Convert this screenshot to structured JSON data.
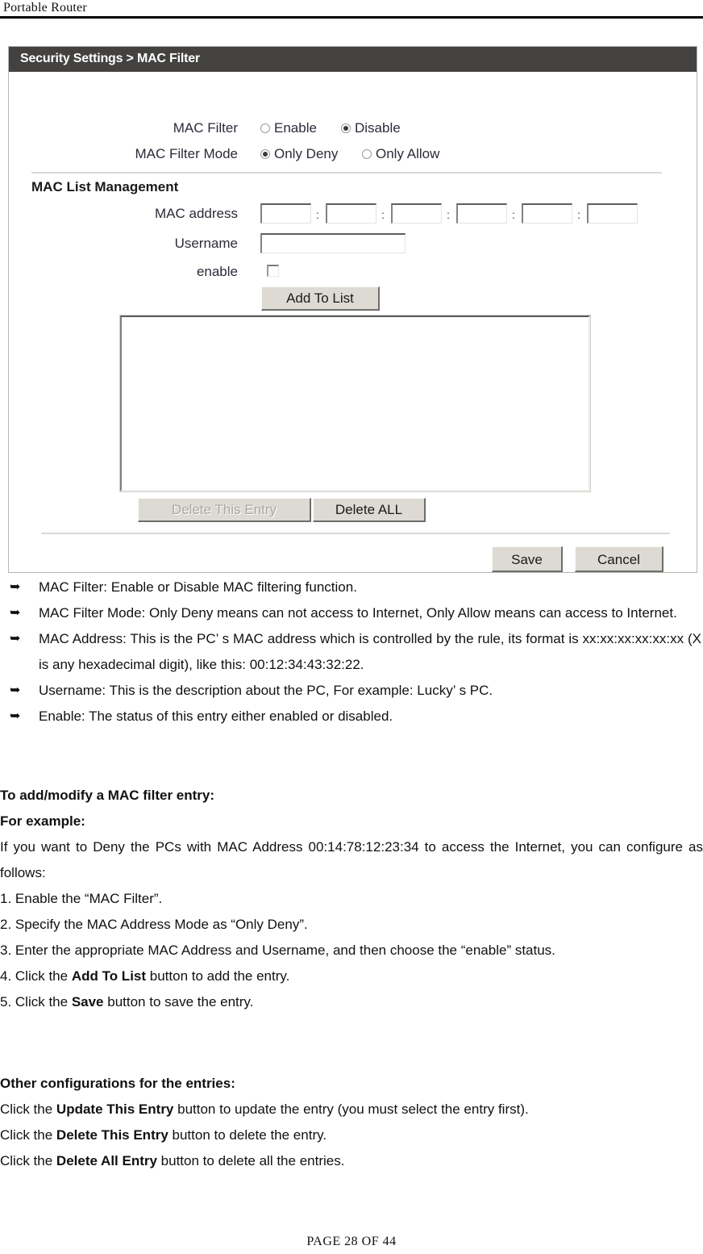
{
  "document": {
    "running_header": "Portable Router",
    "footer": "PAGE   28   OF   44"
  },
  "panel": {
    "breadcrumb": "Security Settings > MAC Filter",
    "accent_header_color": "#434240",
    "fields": {
      "mac_filter": {
        "label": "MAC Filter",
        "options": [
          "Enable",
          "Disable"
        ],
        "selected": "Disable"
      },
      "mac_filter_mode": {
        "label": "MAC Filter Mode",
        "options": [
          "Only Deny",
          "Only Allow"
        ],
        "selected": "Only Deny"
      }
    },
    "list_management": {
      "section_title": "MAC List Management",
      "mac_address_label": "MAC address",
      "mac_address_values": [
        "",
        "",
        "",
        "",
        "",
        ""
      ],
      "separator": ":",
      "username_label": "Username",
      "username_value": "",
      "enable_label": "enable",
      "enable_checked": false,
      "add_to_list_label": "Add To List",
      "entries": [],
      "delete_this_entry_label": "Delete This Entry",
      "delete_this_entry_disabled": true,
      "delete_all_label": "Delete ALL"
    },
    "actions": {
      "save_label": "Save",
      "cancel_label": "Cancel"
    }
  },
  "bullets": [
    "MAC Filter: Enable or Disable MAC filtering function.",
    "MAC Filter Mode: Only Deny means can not access to Internet, Only Allow means can access to Internet.",
    "MAC Address: This is the PC’ s MAC address which is controlled by the rule, its format is xx:xx:xx:xx:xx:xx (X is any hexadecimal digit), like this: 00:12:34:43:32:22.",
    "Username: This is the description about the PC, For example: Lucky’ s PC.",
    "Enable: The status of this entry either enabled or disabled."
  ],
  "instructions": {
    "heading": "To add/modify a MAC filter entry:",
    "example_label": "For example:",
    "intro": "If you want to Deny the PCs with MAC Address 00:14:78:12:23:34 to access the Internet, you can configure as follows:",
    "steps": [
      {
        "prefix": "1. Enable the “MAC Filter”.",
        "bold": "",
        "suffix": ""
      },
      {
        "prefix": "2. Specify the MAC Address Mode as “Only Deny”.",
        "bold": "",
        "suffix": ""
      },
      {
        "prefix": "3. Enter the appropriate MAC Address and Username, and then choose the “enable” status.",
        "bold": "",
        "suffix": ""
      },
      {
        "prefix": "4. Click the ",
        "bold": "Add To List",
        "suffix": " button to add the entry."
      },
      {
        "prefix": "5. Click the ",
        "bold": "Save",
        "suffix": " button to save the entry."
      }
    ]
  },
  "other_config": {
    "heading": "Other configurations for the entries:",
    "lines": [
      {
        "prefix": "Click the ",
        "bold": "Update This Entry",
        "suffix": " button to update the entry (you must select the entry first)."
      },
      {
        "prefix": "Click the ",
        "bold": "Delete This Entry",
        "suffix": " button to delete the entry."
      },
      {
        "prefix": "Click the ",
        "bold": "Delete All Entry",
        "suffix": " button to delete all the entries."
      }
    ]
  }
}
